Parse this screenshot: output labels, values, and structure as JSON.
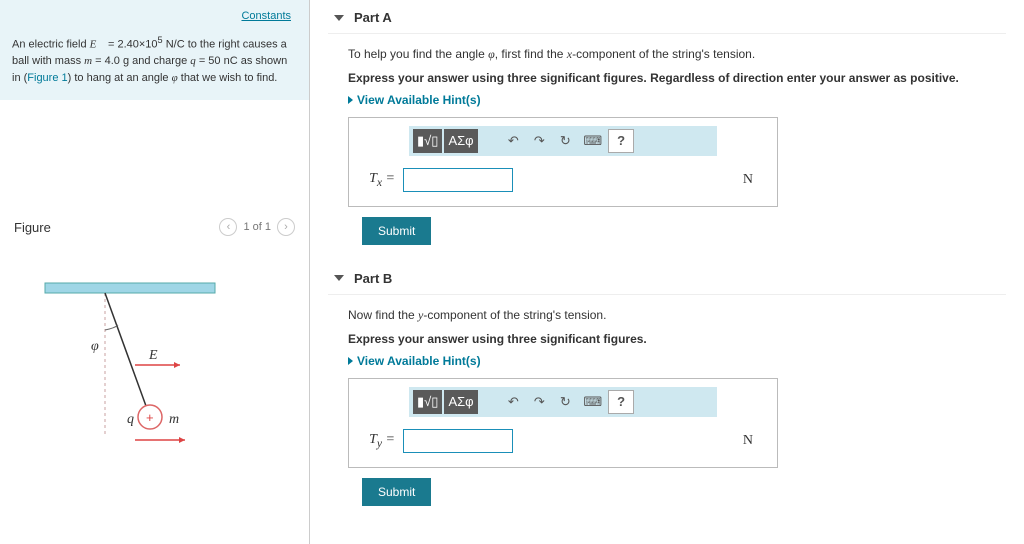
{
  "problem": {
    "constants_link": "Constants",
    "text_html": "An electric field E⃗ = 2.40×10⁵ N/C to the right causes a ball with mass m = 4.0 g and charge q = 50 nC as shown in (Figure 1) to hang at an angle φ that we wish to find."
  },
  "figure": {
    "label": "Figure",
    "pager": "1 of 1"
  },
  "partA": {
    "title": "Part A",
    "instr": "To help you find the angle φ, first find the x-component of the string's tension.",
    "instr_bold": "Express your answer using three significant figures. Regardless of direction enter your answer as positive.",
    "hints": "View Available Hint(s)",
    "label": "Tₓ =",
    "unit": "N",
    "submit": "Submit",
    "tool_sigma": "ΑΣφ"
  },
  "partB": {
    "title": "Part B",
    "instr": "Now find the y-component of the string's tension.",
    "instr_bold": "Express your answer using three significant figures.",
    "hints": "View Available Hint(s)",
    "label": "Tᵧ =",
    "unit": "N",
    "submit": "Submit",
    "tool_sigma": "ΑΣφ"
  }
}
